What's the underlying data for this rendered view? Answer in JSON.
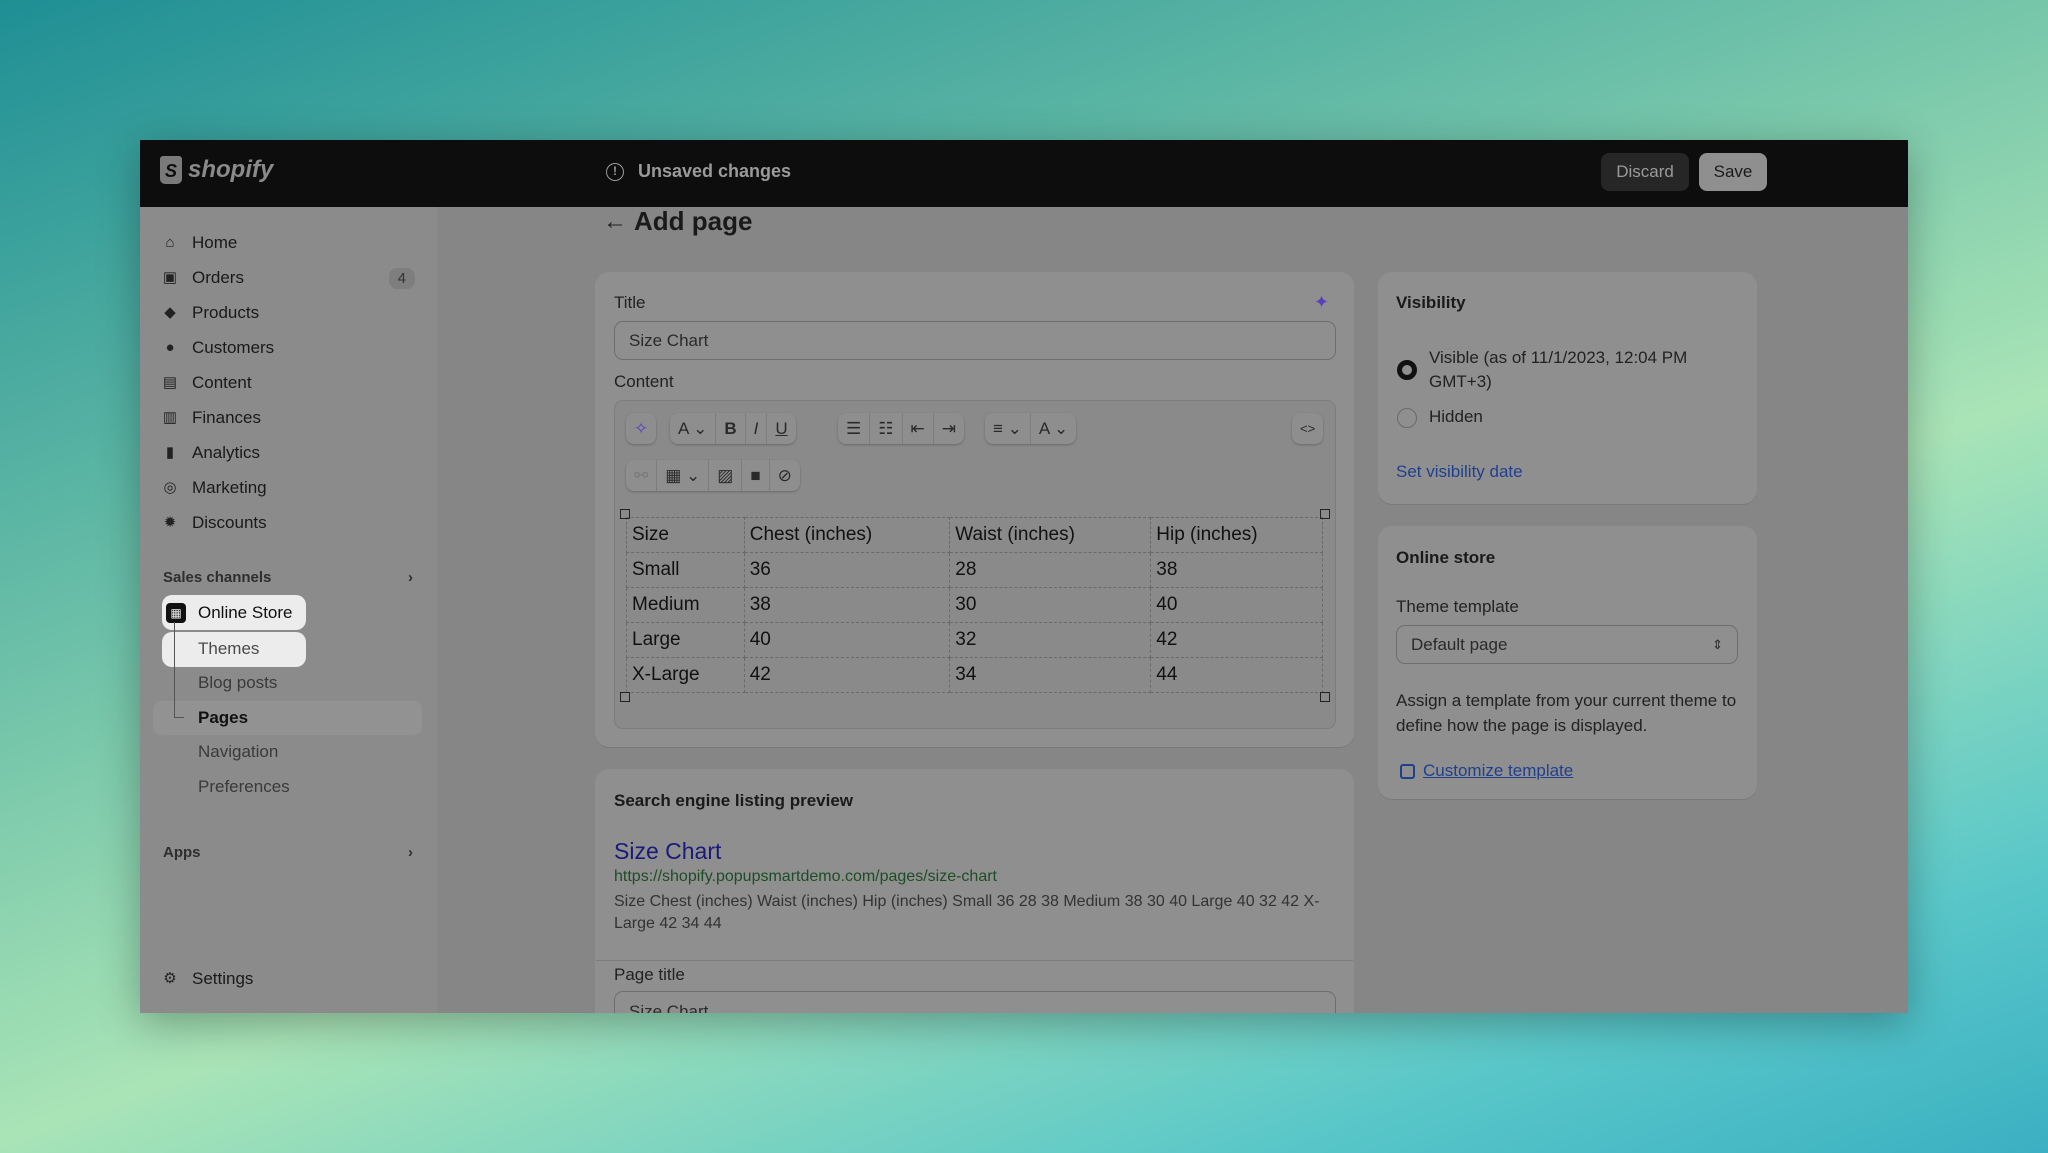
{
  "topbar": {
    "logo": "shopify",
    "status": "Unsaved changes",
    "discard": "Discard",
    "save": "Save"
  },
  "sidebar": {
    "items": [
      {
        "label": "Home",
        "icon": "home-icon"
      },
      {
        "label": "Orders",
        "icon": "orders-icon",
        "badge": "4"
      },
      {
        "label": "Products",
        "icon": "tag-icon"
      },
      {
        "label": "Customers",
        "icon": "person-icon"
      },
      {
        "label": "Content",
        "icon": "content-icon"
      },
      {
        "label": "Finances",
        "icon": "bank-icon"
      },
      {
        "label": "Analytics",
        "icon": "bar-chart-icon"
      },
      {
        "label": "Marketing",
        "icon": "target-icon"
      },
      {
        "label": "Discounts",
        "icon": "discount-icon"
      }
    ],
    "sales_channels": "Sales channels",
    "online_store": "Online Store",
    "sub_items": [
      "Themes",
      "Blog posts",
      "Pages",
      "Navigation",
      "Preferences"
    ],
    "apps": "Apps",
    "settings": "Settings"
  },
  "page": {
    "title": "Add page"
  },
  "editor": {
    "title_label": "Title",
    "title_value": "Size Chart",
    "content_label": "Content",
    "table": {
      "headers": [
        "Size",
        "Chest (inches)",
        "Waist (inches)",
        "Hip (inches)"
      ],
      "rows": [
        [
          "Small",
          "36",
          "28",
          "38"
        ],
        [
          "Medium",
          "38",
          "30",
          "40"
        ],
        [
          "Large",
          "40",
          "32",
          "42"
        ],
        [
          "X-Large",
          "42",
          "34",
          "44"
        ]
      ]
    }
  },
  "seo": {
    "heading": "Search engine listing preview",
    "title": "Size Chart",
    "url": "https://shopify.popupsmartdemo.com/pages/size-chart",
    "description": "Size Chest (inches) Waist (inches) Hip (inches) Small 36 28 38 Medium 38 30 40 Large 40 32 42 X-Large 42 34 44",
    "page_title_label": "Page title",
    "page_title_value": "Size Chart"
  },
  "visibility": {
    "heading": "Visibility",
    "visible": "Visible (as of 11/1/2023, 12:04 PM GMT+3)",
    "hidden": "Hidden",
    "selected": "visible",
    "set_date": "Set visibility date"
  },
  "online_store": {
    "heading": "Online store",
    "template_label": "Theme template",
    "template_value": "Default page",
    "help": "Assign a template from your current theme to define how the page is displayed.",
    "customize": "Customize template"
  },
  "colors": {
    "link": "#1f3f8f",
    "seo_title": "#1a1a7a",
    "seo_url": "#1d4d26",
    "ai": "#5a3fbf"
  }
}
